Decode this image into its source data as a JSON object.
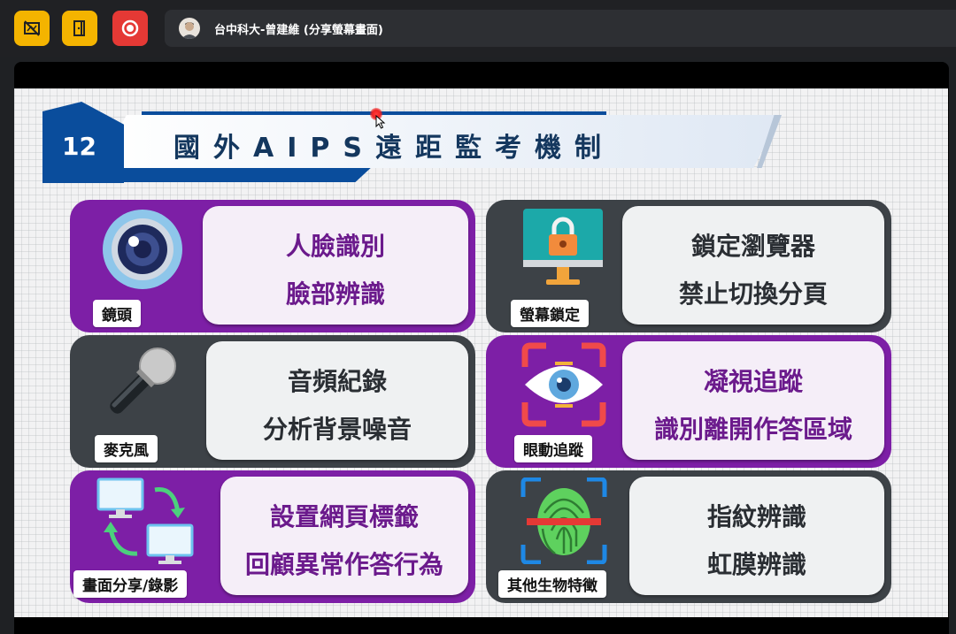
{
  "toolbar": {
    "buttons": [
      {
        "name": "hide-video-icon",
        "color": "#f4b400"
      },
      {
        "name": "exit-door-icon",
        "color": "#f4b400"
      },
      {
        "name": "record-icon",
        "color": "#e53935"
      }
    ]
  },
  "presenter": {
    "name": "台中科大-曾建維 (分享螢幕畫面)"
  },
  "slide": {
    "number": "12",
    "title": "國外AIPS遠距監考機制",
    "cards": [
      {
        "tag": "鏡頭",
        "line1": "人臉識別",
        "line2": "臉部辨識",
        "theme": "purple",
        "icon": "camera-lens-icon"
      },
      {
        "tag": "螢幕鎖定",
        "line1": "鎖定瀏覽器",
        "line2": "禁止切換分頁",
        "theme": "dark",
        "icon": "locked-monitor-icon"
      },
      {
        "tag": "麥克風",
        "line1": "音頻紀錄",
        "line2": "分析背景噪音",
        "theme": "dark",
        "icon": "microphone-icon"
      },
      {
        "tag": "眼動追蹤",
        "line1": "凝視追蹤",
        "line2": "識別離開作答區域",
        "theme": "purple",
        "icon": "eye-tracking-icon"
      },
      {
        "tag": "畫面分享/錄影",
        "line1": "設置網頁標籤",
        "line2": "回顧異常作答行為",
        "theme": "purple",
        "icon": "screen-share-icon"
      },
      {
        "tag": "其他生物特徵",
        "line1": "指紋辨識",
        "line2": "虹膜辨識",
        "theme": "dark",
        "icon": "fingerprint-icon"
      }
    ]
  },
  "colors": {
    "purple": "#7d1fa6",
    "dark": "#3d4247",
    "banner_blue": "#0a4d9c"
  }
}
